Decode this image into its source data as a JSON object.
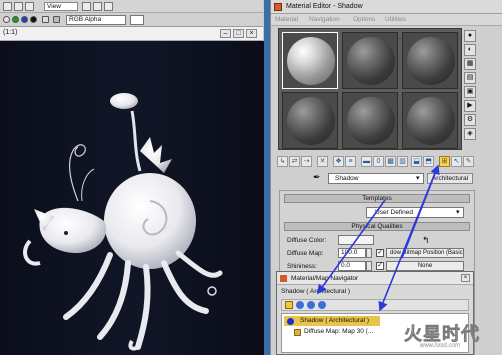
{
  "viewport": {
    "view_label": "View",
    "channel": "RGB Alpha",
    "frame_label": "(1:1)"
  },
  "material_editor": {
    "title": "Material Editor - Shadow",
    "menu": [
      "Material",
      "Navigation",
      "Options",
      "Utilities"
    ],
    "material_name": "Shadow",
    "material_type": "Architectural",
    "rollout_templates": "Templates",
    "template_value": "User Defined",
    "rollout_physical": "Physical Qualities",
    "diffuse_color_label": "Diffuse Color:",
    "diffuse_map_label": "Diffuse Map:",
    "diffuse_map_value": "100.0",
    "diffuse_map_button": "dow Bitmap Position (Basic)",
    "shininess_label": "Shininess:",
    "shininess_value": "0.0",
    "shininess_button": "None"
  },
  "navigator": {
    "title": "Material/Map Navigator",
    "current": "Shadow ( Architectural )",
    "tree_root": "Shadow ( Architectural )",
    "tree_child": "Diffuse Map: Map 30 (..."
  },
  "watermark": {
    "text": "火星时代",
    "sub": "www.hxsd.com"
  },
  "colors": {
    "accent_blue": "#3a6ea8",
    "render_bg": "#0c0f1d",
    "arrow": "#2d39d8",
    "selection": "#e8c44a"
  }
}
